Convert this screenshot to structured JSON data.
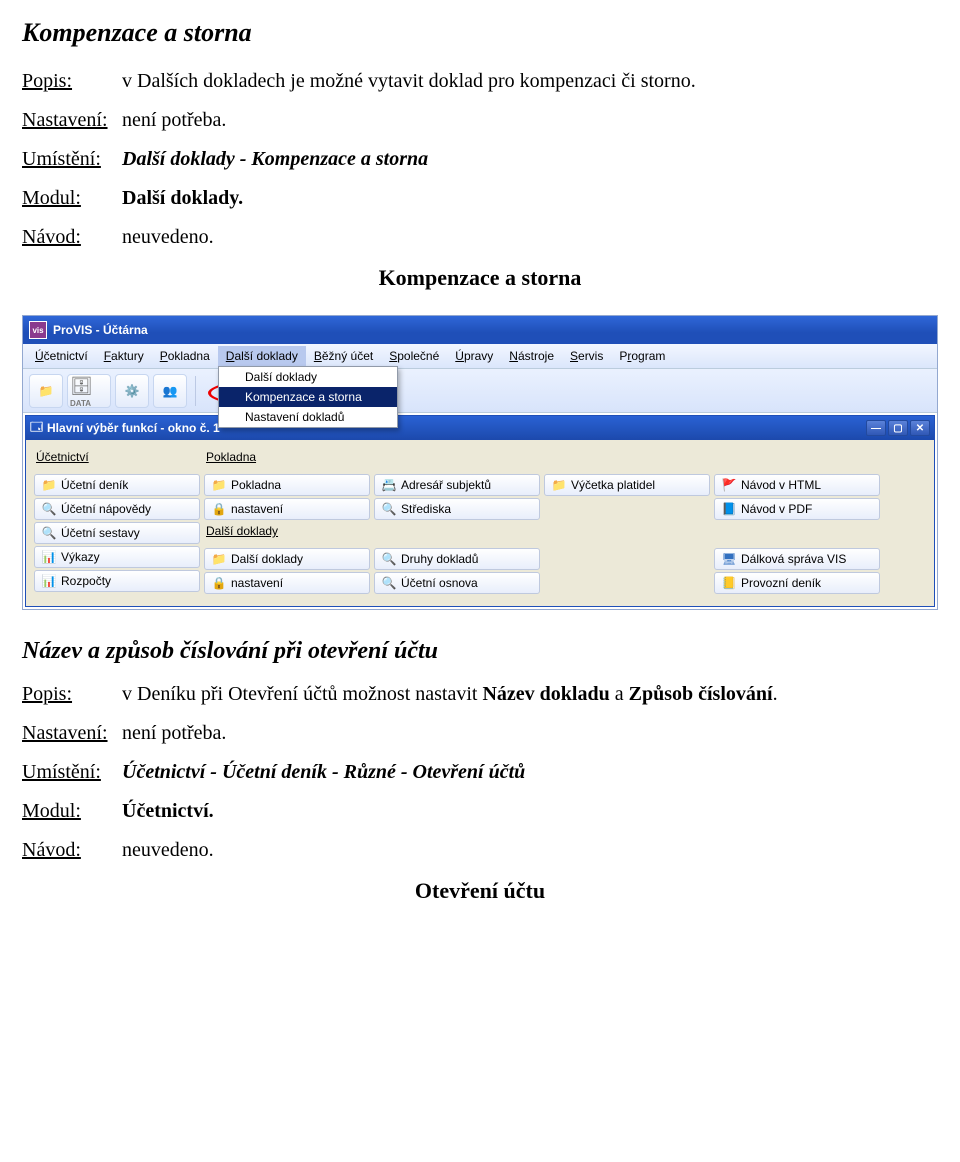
{
  "section1": {
    "heading": "Kompenzace a storna",
    "popis_label": "Popis:",
    "popis_val": "v Dalších dokladech je možné vytavit doklad pro kompenzaci či storno.",
    "nastaveni_label": "Nastavení:",
    "nastaveni_val": "není potřeba.",
    "umisteni_label": "Umístění:",
    "umisteni_val": "Další doklady - Kompenzace a storna",
    "modul_label": "Modul:",
    "modul_val": "Další doklady.",
    "navod_label": "Návod:",
    "navod_val": "neuvedeno.",
    "center": "Kompenzace a storna"
  },
  "app": {
    "title": "ProVIS - Účtárna",
    "menus": [
      "Účetnictví",
      "Faktury",
      "Pokladna",
      "Další doklady",
      "Běžný účet",
      "Společné",
      "Úpravy",
      "Nástroje",
      "Servis",
      "Program"
    ],
    "menu_underline_idx": [
      0,
      0,
      0,
      0,
      0,
      0,
      0,
      0,
      0,
      1
    ],
    "open_menu": 3,
    "dropdown": [
      "Další doklady",
      "Kompenzace a storna",
      "Nastavení dokladů"
    ],
    "dropdown_sel": 1,
    "toolbar_data": "DATA",
    "inner_title": "Hlavní výběr funkcí - okno č. 1",
    "cols": [
      {
        "head": "Účetnictví",
        "items": [
          {
            "ico": "folder",
            "txt": "Účetní deník"
          },
          {
            "ico": "mag",
            "txt": "Účetní nápovědy"
          },
          {
            "ico": "mag",
            "txt": "Účetní sestavy"
          },
          {
            "ico": "chart",
            "txt": "Výkazy"
          },
          {
            "ico": "chart",
            "txt": "Rozpočty"
          }
        ]
      },
      {
        "head": "Pokladna",
        "items": [
          {
            "ico": "folder",
            "txt": "Pokladna"
          },
          {
            "ico": "lock",
            "txt": "nastavení"
          }
        ],
        "head2": "Další doklady",
        "items2": [
          {
            "ico": "folder",
            "txt": "Další doklady"
          },
          {
            "ico": "lock",
            "txt": "nastavení"
          }
        ]
      },
      {
        "head": "",
        "items": [
          {
            "ico": "book",
            "txt": "Adresář subjektů"
          },
          {
            "ico": "mag",
            "txt": "Střediska"
          },
          null,
          {
            "ico": "mag",
            "txt": "Druhy dokladů"
          },
          {
            "ico": "mag",
            "txt": "Účetní osnova"
          }
        ]
      },
      {
        "head": "",
        "items": [
          {
            "ico": "folder",
            "txt": "Výčetka platidel"
          }
        ]
      },
      {
        "head": "",
        "items": [
          {
            "ico": "flag",
            "txt": "Návod v HTML"
          },
          {
            "ico": "pdf",
            "txt": "Návod v PDF"
          },
          null,
          {
            "ico": "remote",
            "txt": "Dálková správa VIS"
          },
          {
            "ico": "diary",
            "txt": "Provozní deník"
          }
        ]
      }
    ]
  },
  "section2": {
    "heading": "Název a způsob číslování při otevření účtu",
    "popis_label": "Popis:",
    "popis_val_pre": "v Deníku při Otevření účtů možnost nastavit ",
    "popis_val_b1": "Název dokladu",
    "popis_val_mid": " a ",
    "popis_val_b2": "Způsob číslování",
    "popis_val_post": ".",
    "nastaveni_label": "Nastavení:",
    "nastaveni_val": "není potřeba.",
    "umisteni_label": "Umístění:",
    "umisteni_val": "Účetnictví - Účetní deník - Různé - Otevření účtů",
    "modul_label": "Modul:",
    "modul_val": "Účetnictví.",
    "navod_label": "Návod:",
    "navod_val": "neuvedeno.",
    "center": "Otevření účtu"
  }
}
